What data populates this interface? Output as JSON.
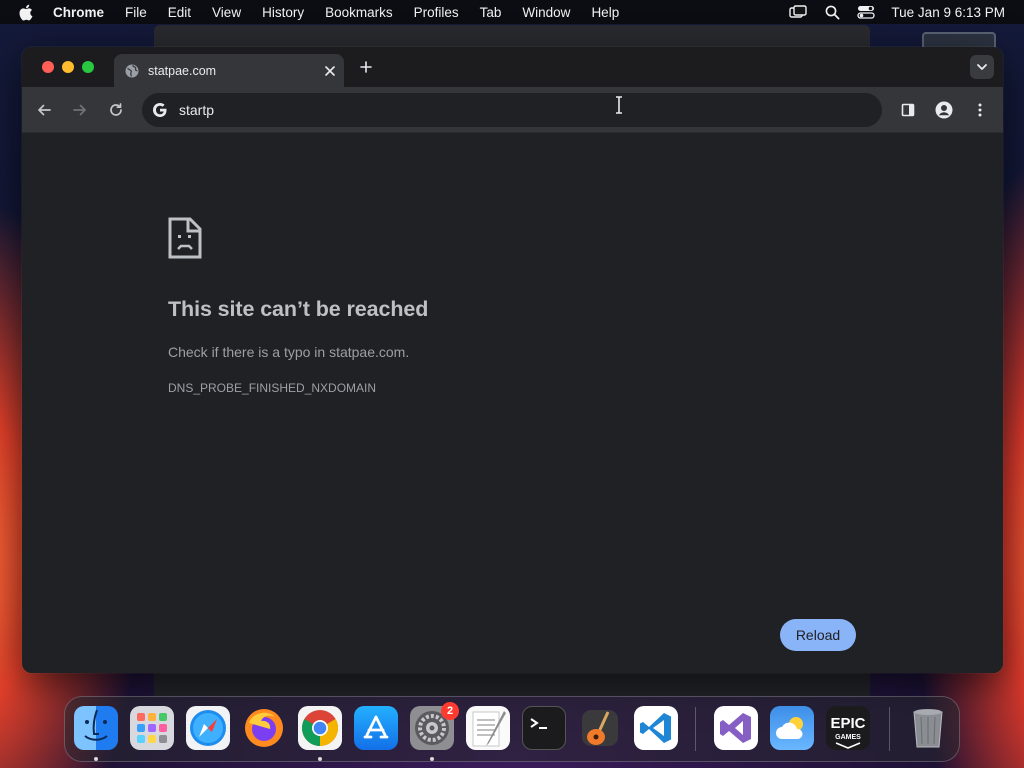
{
  "menubar": {
    "app_name": "Chrome",
    "items": [
      "File",
      "Edit",
      "View",
      "History",
      "Bookmarks",
      "Profiles",
      "Tab",
      "Window",
      "Help"
    ],
    "clock": "Tue Jan 9  6:13 PM"
  },
  "browser": {
    "tab": {
      "title": "statpae.com",
      "favicon": "globe-icon"
    },
    "omnibox": {
      "value": "startp",
      "icon": "google-g-icon"
    }
  },
  "error_page": {
    "icon": "sad-page-icon",
    "title": "This site can’t be reached",
    "message": "Check if there is a typo in statpae.com.",
    "code": "DNS_PROBE_FINISHED_NXDOMAIN",
    "reload_label": "Reload"
  },
  "dock": {
    "apps": [
      "Finder",
      "Launchpad",
      "Safari",
      "Firefox",
      "Google Chrome",
      "App Store",
      "System Settings",
      "TextEdit",
      "Terminal",
      "GarageBand",
      "Visual Studio Code",
      "Visual Studio",
      "Weather",
      "Epic Games Launcher",
      "Trash"
    ],
    "settings_badge": "2",
    "epic_label_line1": "EPIC",
    "epic_label_line2": "GAMES"
  },
  "colors": {
    "accent": "#8ab4f8",
    "page_bg": "#202124",
    "toolbar_bg": "#35363a"
  }
}
